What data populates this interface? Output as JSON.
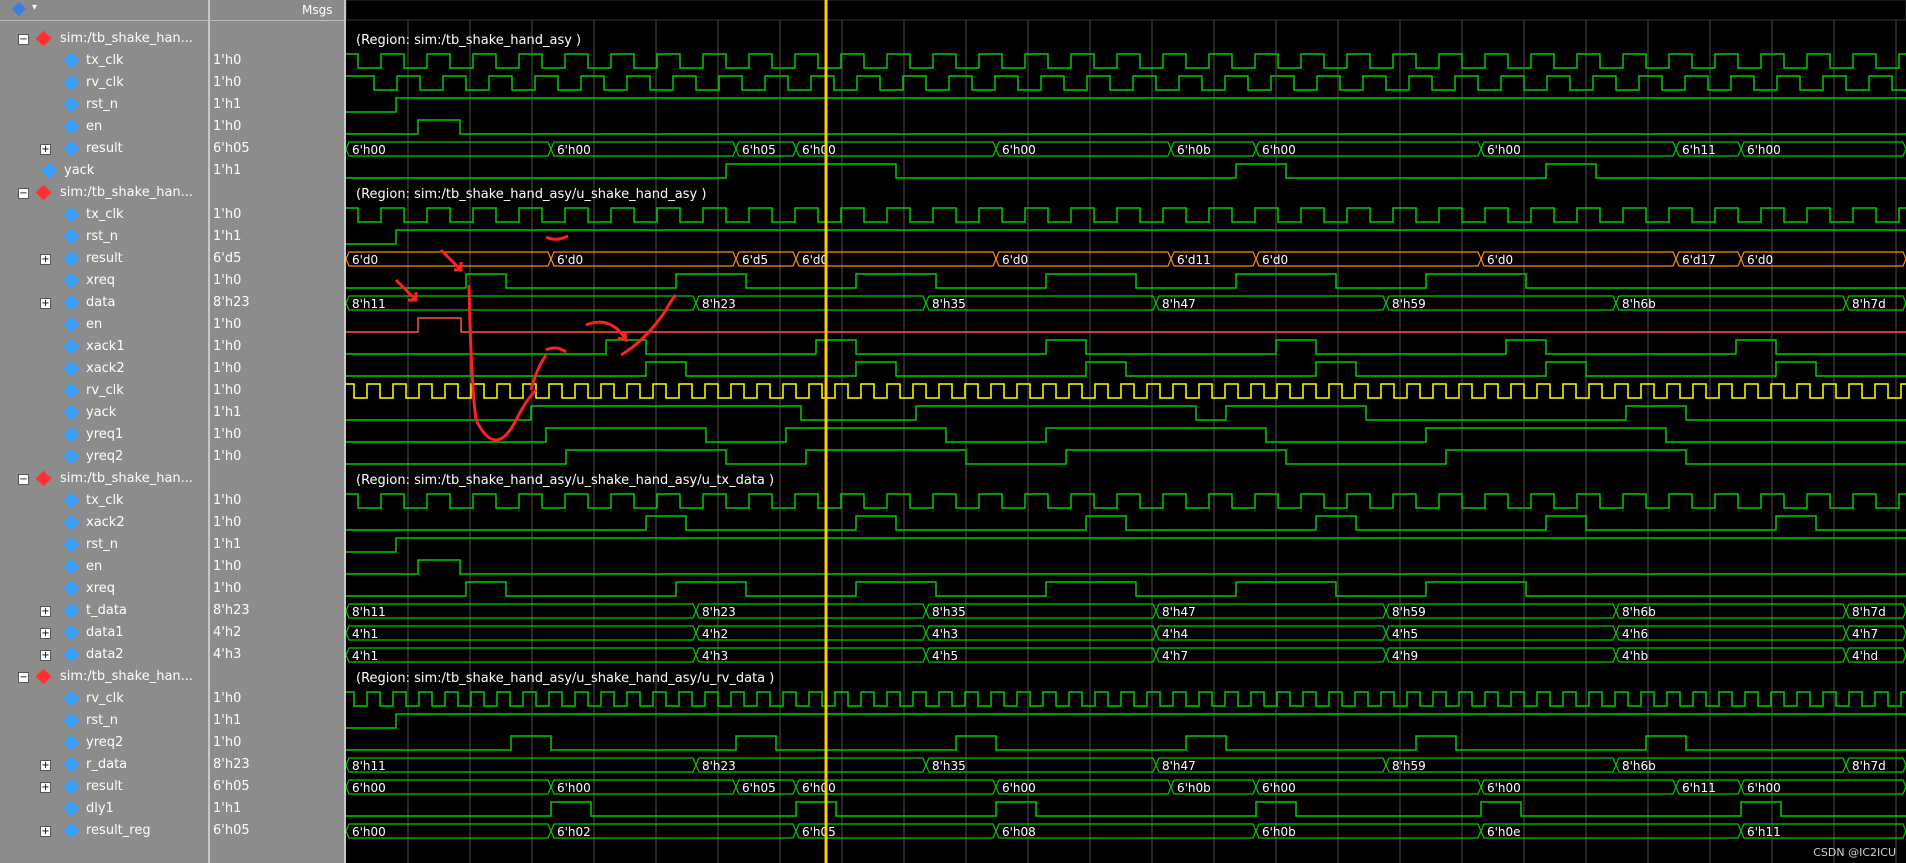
{
  "header": {
    "msgs_label": "Msgs"
  },
  "regions": [
    "(Region: sim:/tb_shake_hand_asy )",
    "(Region: sim:/tb_shake_hand_asy/u_shake_hand_asy )",
    "(Region: sim:/tb_shake_hand_asy/u_shake_hand_asy/u_tx_data )",
    "(Region: sim:/tb_shake_hand_asy/u_shake_hand_asy/u_rv_data )"
  ],
  "signals": [
    {
      "name": "sim:/tb_shake_han...",
      "value": "",
      "kind": "group",
      "level": 0,
      "color": "#ff3030"
    },
    {
      "name": "tx_clk",
      "value": "1'h0",
      "kind": "in",
      "level": 1,
      "color": "#3aa0ff"
    },
    {
      "name": "rv_clk",
      "value": "1'h0",
      "kind": "in",
      "level": 1,
      "color": "#3aa0ff"
    },
    {
      "name": "rst_n",
      "value": "1'h1",
      "kind": "in",
      "level": 1,
      "color": "#3aa0ff"
    },
    {
      "name": "en",
      "value": "1'h0",
      "kind": "in",
      "level": 1,
      "color": "#3aa0ff"
    },
    {
      "name": "result",
      "value": "6'h05",
      "kind": "bus",
      "level": 1,
      "color": "#3aa0ff"
    },
    {
      "name": "yack",
      "value": "1'h1",
      "kind": "in",
      "level": 0,
      "color": "#3aa0ff"
    },
    {
      "name": "sim:/tb_shake_han...",
      "value": "",
      "kind": "group",
      "level": 0,
      "color": "#ff3030"
    },
    {
      "name": "tx_clk",
      "value": "1'h0",
      "kind": "in",
      "level": 1,
      "color": "#3aa0ff"
    },
    {
      "name": "rst_n",
      "value": "1'h1",
      "kind": "in",
      "level": 1,
      "color": "#3aa0ff"
    },
    {
      "name": "result",
      "value": "6'd5",
      "kind": "bus",
      "level": 1,
      "color": "#3aa0ff"
    },
    {
      "name": "xreq",
      "value": "1'h0",
      "kind": "out",
      "level": 1,
      "color": "#3aa0ff"
    },
    {
      "name": "data",
      "value": "8'h23",
      "kind": "bus",
      "level": 1,
      "color": "#3aa0ff"
    },
    {
      "name": "en",
      "value": "1'h0",
      "kind": "out",
      "level": 1,
      "color": "#3aa0ff"
    },
    {
      "name": "xack1",
      "value": "1'h0",
      "kind": "out",
      "level": 1,
      "color": "#3aa0ff"
    },
    {
      "name": "xack2",
      "value": "1'h0",
      "kind": "out",
      "level": 1,
      "color": "#3aa0ff"
    },
    {
      "name": "rv_clk",
      "value": "1'h0",
      "kind": "in",
      "level": 1,
      "color": "#3aa0ff"
    },
    {
      "name": "yack",
      "value": "1'h1",
      "kind": "out",
      "level": 1,
      "color": "#3aa0ff"
    },
    {
      "name": "yreq1",
      "value": "1'h0",
      "kind": "out",
      "level": 1,
      "color": "#3aa0ff"
    },
    {
      "name": "yreq2",
      "value": "1'h0",
      "kind": "out",
      "level": 1,
      "color": "#3aa0ff"
    },
    {
      "name": "sim:/tb_shake_han...",
      "value": "",
      "kind": "group",
      "level": 0,
      "color": "#ff3030"
    },
    {
      "name": "tx_clk",
      "value": "1'h0",
      "kind": "in",
      "level": 1,
      "color": "#3aa0ff"
    },
    {
      "name": "xack2",
      "value": "1'h0",
      "kind": "in",
      "level": 1,
      "color": "#3aa0ff"
    },
    {
      "name": "rst_n",
      "value": "1'h1",
      "kind": "in",
      "level": 1,
      "color": "#3aa0ff"
    },
    {
      "name": "en",
      "value": "1'h0",
      "kind": "in",
      "level": 1,
      "color": "#3aa0ff"
    },
    {
      "name": "xreq",
      "value": "1'h0",
      "kind": "out",
      "level": 1,
      "color": "#3aa0ff"
    },
    {
      "name": "t_data",
      "value": "8'h23",
      "kind": "bus",
      "level": 1,
      "color": "#3aa0ff"
    },
    {
      "name": "data1",
      "value": "4'h2",
      "kind": "bus",
      "level": 1,
      "color": "#3aa0ff"
    },
    {
      "name": "data2",
      "value": "4'h3",
      "kind": "bus",
      "level": 1,
      "color": "#3aa0ff"
    },
    {
      "name": "sim:/tb_shake_han...",
      "value": "",
      "kind": "group",
      "level": 0,
      "color": "#ff3030"
    },
    {
      "name": "rv_clk",
      "value": "1'h0",
      "kind": "in",
      "level": 1,
      "color": "#3aa0ff"
    },
    {
      "name": "rst_n",
      "value": "1'h1",
      "kind": "in",
      "level": 1,
      "color": "#3aa0ff"
    },
    {
      "name": "yreq2",
      "value": "1'h0",
      "kind": "in",
      "level": 1,
      "color": "#3aa0ff"
    },
    {
      "name": "r_data",
      "value": "8'h23",
      "kind": "bus",
      "level": 1,
      "color": "#3aa0ff"
    },
    {
      "name": "result",
      "value": "6'h05",
      "kind": "bus",
      "level": 1,
      "color": "#3aa0ff"
    },
    {
      "name": "dly1",
      "value": "1'h1",
      "kind": "out",
      "level": 1,
      "color": "#3aa0ff"
    },
    {
      "name": "result_reg",
      "value": "6'h05",
      "kind": "bus",
      "level": 1,
      "color": "#3aa0ff"
    }
  ],
  "bus_labels": {
    "result_top": [
      "6'h00",
      "6'h00",
      "6'h05",
      "6'h00",
      "6'h00",
      "6'h0b",
      "6'h00",
      "6'h00",
      "6'h11",
      "6'h00"
    ],
    "result_dec": [
      "6'd0",
      "6'd0",
      "6'd5",
      "6'd0",
      "6'd0",
      "6'd11",
      "6'd0",
      "6'd0",
      "6'd17",
      "6'd0"
    ],
    "data_hex": [
      "8'h11",
      "8'h23",
      "8'h35",
      "8'h47",
      "8'h59",
      "8'h6b",
      "8'h7d"
    ],
    "data1": [
      "4'h1",
      "4'h2",
      "4'h3",
      "4'h4",
      "4'h5",
      "4'h6",
      "4'h7"
    ],
    "data2": [
      "4'h1",
      "4'h3",
      "4'h5",
      "4'h7",
      "4'h9",
      "4'hb",
      "4'hd"
    ],
    "result_reg": [
      "6'h00",
      "6'h02",
      "6'h05",
      "6'h08",
      "6'h0b",
      "6'h0e",
      "6'h11"
    ]
  },
  "colors": {
    "wave": "#00cc00",
    "clk_rv": "#ffff00",
    "cursor": "#ffcc00",
    "bus_orange": "#ff8c00",
    "en_red": "#ff5533",
    "annot": "#ff2020",
    "grid": "#505050"
  },
  "watermark": "CSDN @IC2ICU"
}
